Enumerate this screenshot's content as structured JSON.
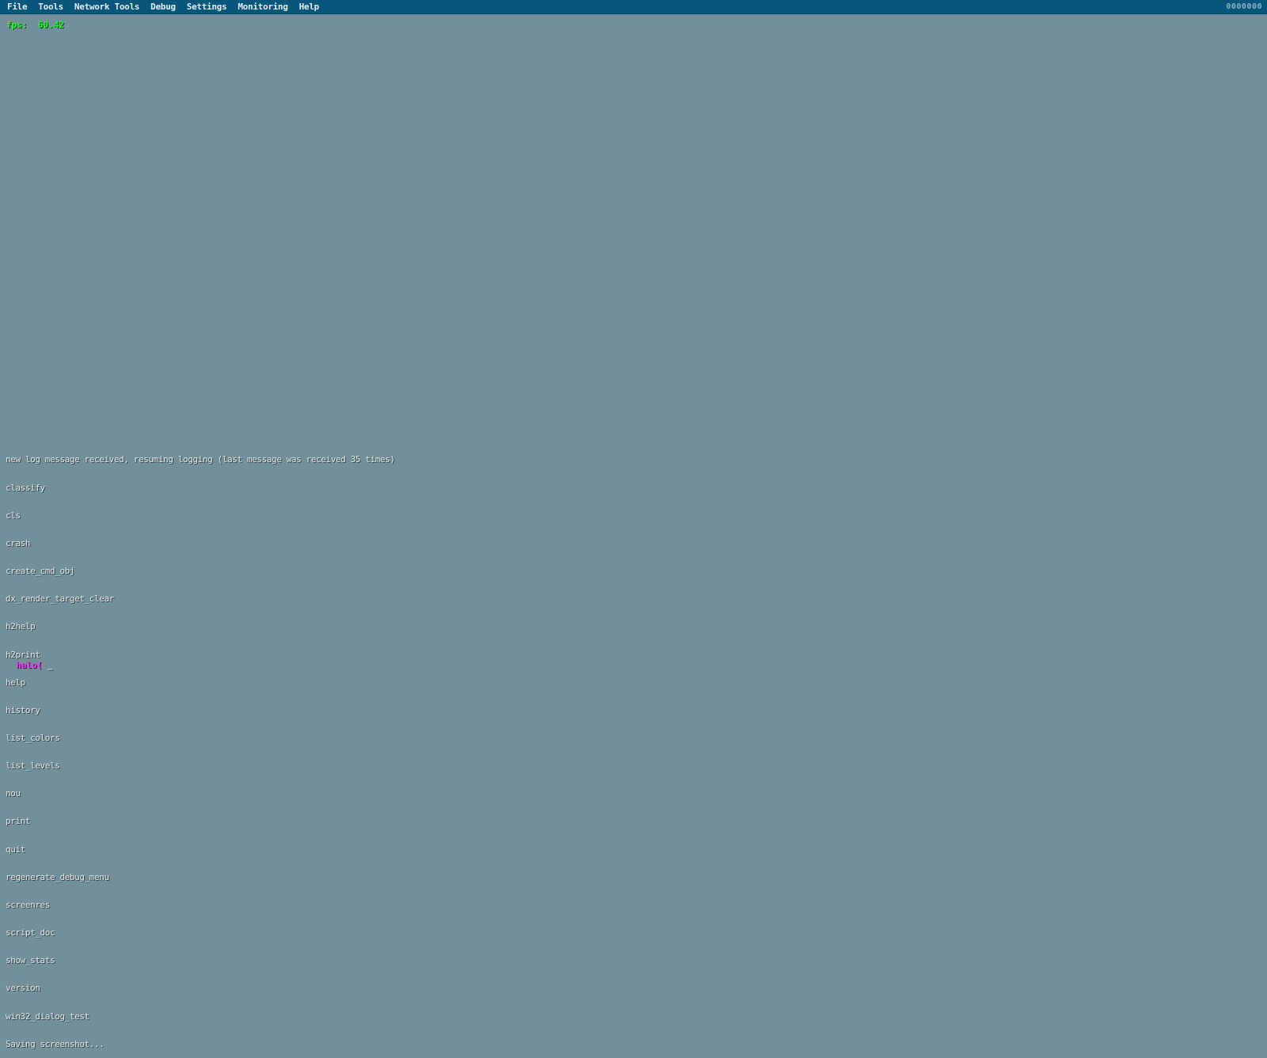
{
  "menubar": {
    "items": [
      "File",
      "Tools",
      "Network Tools",
      "Debug",
      "Settings",
      "Monitoring",
      "Help"
    ],
    "right_text": "0000000"
  },
  "fps": {
    "text": "fps:  60.42"
  },
  "console": {
    "lines": [
      "new log message received, resuming logging (last message was received 35 times)",
      "classify",
      "cls",
      "crash",
      "create_cmd_obj",
      "dx_render_target_clear",
      "h2help",
      "h2print",
      "help",
      "history",
      "list_colors",
      "list_levels",
      "nou",
      "print",
      "quit",
      "regenerate_debug_menu",
      "screenres",
      "script_doc",
      "show_stats",
      "version",
      "win32_dialog_test",
      "Saving screenshot..."
    ],
    "prompt_label": "halo(",
    "prompt_input": " _"
  },
  "colors": {
    "background": "#71909a",
    "menubar": "#07567c",
    "fps_text": "#1aff2a",
    "prompt_label": "#ff2cff",
    "log_text": "#e8e8e8"
  }
}
